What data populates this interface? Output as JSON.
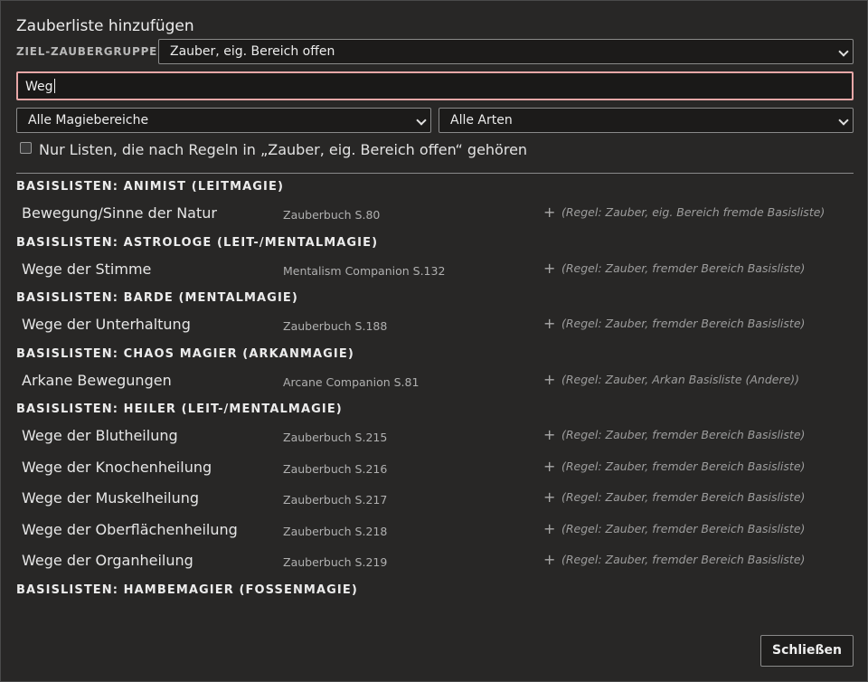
{
  "dialog": {
    "title": "Zauberliste hinzufügen",
    "target_label": "ZIEL-ZAUBERGRUPPE",
    "target_value": "Zauber, eig. Bereich offen",
    "search_value": "Weg",
    "filter_realm": "Alle Magiebereiche",
    "filter_kind": "Alle Arten",
    "checkbox_label": "Nur Listen, die nach Regeln in „Zauber, eig. Bereich offen“ gehören",
    "close_label": "Schließen"
  },
  "add_symbol": "+",
  "groups": [
    {
      "header": "BASISLISTEN: ANIMIST (LEITMAGIE)",
      "items": [
        {
          "name": "Bewegung/Sinne der Natur",
          "source": "Zauberbuch S.80",
          "rule": "(Regel: Zauber, eig. Bereich fremde Basisliste)"
        }
      ]
    },
    {
      "header": "BASISLISTEN: ASTROLOGE (LEIT-/MENTALMAGIE)",
      "items": [
        {
          "name": "Wege der Stimme",
          "source": "Mentalism Companion S.132",
          "rule": "(Regel: Zauber, fremder Bereich Basisliste)"
        }
      ]
    },
    {
      "header": "BASISLISTEN: BARDE (MENTALMAGIE)",
      "items": [
        {
          "name": "Wege der Unterhaltung",
          "source": "Zauberbuch S.188",
          "rule": "(Regel: Zauber, fremder Bereich Basisliste)"
        }
      ]
    },
    {
      "header": "BASISLISTEN: CHAOS MAGIER (ARKANMAGIE)",
      "items": [
        {
          "name": "Arkane Bewegungen",
          "source": "Arcane Companion S.81",
          "rule": "(Regel: Zauber, Arkan Basisliste (Andere))"
        }
      ]
    },
    {
      "header": "BASISLISTEN: HEILER (LEIT-/MENTALMAGIE)",
      "items": [
        {
          "name": "Wege der Blutheilung",
          "source": "Zauberbuch S.215",
          "rule": "(Regel: Zauber, fremder Bereich Basisliste)"
        },
        {
          "name": "Wege der Knochenheilung",
          "source": "Zauberbuch S.216",
          "rule": "(Regel: Zauber, fremder Bereich Basisliste)"
        },
        {
          "name": "Wege der Muskelheilung",
          "source": "Zauberbuch S.217",
          "rule": "(Regel: Zauber, fremder Bereich Basisliste)"
        },
        {
          "name": "Wege der Oberflächenheilung",
          "source": "Zauberbuch S.218",
          "rule": "(Regel: Zauber, fremder Bereich Basisliste)"
        },
        {
          "name": "Wege der Organheilung",
          "source": "Zauberbuch S.219",
          "rule": "(Regel: Zauber, fremder Bereich Basisliste)"
        }
      ]
    },
    {
      "header": "BASISLISTEN: HAMBEMAGIER (FOSSENMAGIE)",
      "items": []
    }
  ]
}
